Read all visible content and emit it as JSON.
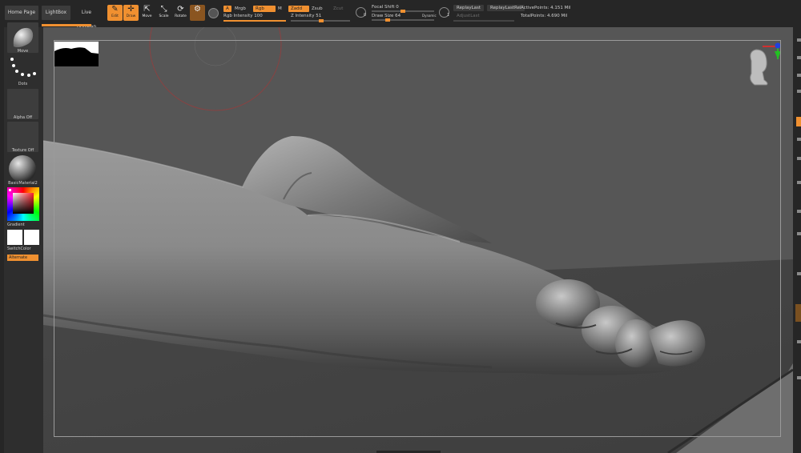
{
  "menus": {
    "home_page": "Home Page",
    "lightbox": "LightBox",
    "live_boolean": "Live Boolean"
  },
  "tools": {
    "edit": "Edit",
    "draw": "Draw",
    "move": "Move",
    "scale": "Scale",
    "rotate": "Rotate"
  },
  "draw_settings": {
    "a_label": "A",
    "mrgb": "Mrgb",
    "rgb": "Rgb",
    "m": "M",
    "zadd": "Zadd",
    "zsub": "Zsub",
    "zcut": "Zcut",
    "rgb_intensity": "Rgb Intensity 100",
    "z_intensity": "Z Intensity 51",
    "focal_shift": "Focal Shift 0",
    "draw_size": "Draw Size 64",
    "dynamic": "Dynamic",
    "replay_last": "ReplayLast",
    "replay_last_rel": "ReplayLastRel",
    "adjust_last": "AdjustLast",
    "adjust_last_value": "1",
    "focal_icon_value": "0",
    "rgb_intensity_level": 1.0,
    "z_intensity_level": 0.51,
    "focal_shift_level": 0.5,
    "draw_size_level": 0.25
  },
  "stats": {
    "active_points": "ActivePoints: 4.151 Mil",
    "total_points": "TotalPoints: 4.690 Mil"
  },
  "left_shelf": {
    "brush": "Move",
    "stroke": "Dots",
    "alpha": "Alpha Off",
    "texture": "Texture Off",
    "material": "BasicMaterial2",
    "gradient": "Gradient",
    "switch_color": "SwitchColor",
    "alternate": "Alternate"
  },
  "colors": {
    "accent": "#f09030",
    "background": "#535353",
    "panel": "#2e2e2e",
    "topbar": "#262626"
  },
  "icons": {
    "edit": "pencil-icon",
    "draw": "draw-icon",
    "move": "move-icon",
    "scale": "scale-icon",
    "rotate": "rotate-icon",
    "gizmo": "head-navigation-icon"
  }
}
